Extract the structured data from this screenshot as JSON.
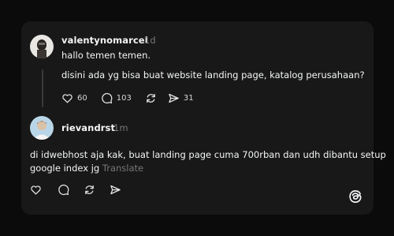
{
  "posts": [
    {
      "username": "valentynomarcel",
      "time": "1d",
      "paragraphs": [
        "hallo temen temen.",
        "disini ada yg bisa buat website landing page, katalog perusahaan?"
      ],
      "stats": {
        "likes": "60",
        "replies": "103",
        "shares": "31"
      }
    },
    {
      "username": "rievandrst",
      "time": "1m",
      "lines": [
        "di idwebhost aja kak, buat landing page cuma 700rban dan udh dibantu setup",
        "google index jg"
      ],
      "translate": "Translate"
    }
  ],
  "icons": {
    "like": "heart-icon",
    "reply": "comment-icon",
    "repost": "repost-icon",
    "share": "send-icon",
    "logo": "threads-logo-icon"
  },
  "colors": {
    "background": "#0b0b0b",
    "card": "#181818",
    "text": "#f3f5f7",
    "muted": "#777777"
  }
}
